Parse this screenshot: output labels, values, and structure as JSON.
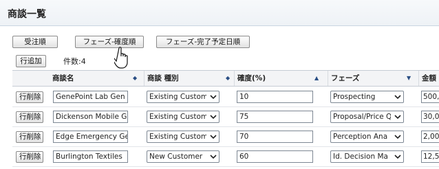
{
  "page": {
    "title": "商談一覧"
  },
  "toolbar": {
    "sort_received": "受注順",
    "sort_phase_certainty": "フェーズ-確度順",
    "sort_phase_close_date": "フェーズ-完了予定日順",
    "add_row": "行追加",
    "count": "件数:4"
  },
  "table": {
    "columns": [
      "商談名",
      "商談 種別",
      "確度(%)",
      "フェーズ",
      "金額"
    ],
    "delete_label": "行削除",
    "rows": [
      {
        "name": "GenePoint Lab Gen",
        "type": "Existing Custom",
        "prob": "10",
        "phase": "Prospecting",
        "amount": "500,0"
      },
      {
        "name": "Dickenson Mobile G",
        "type": "Existing Custom",
        "prob": "75",
        "phase": "Proposal/Price Q",
        "amount": "30,00"
      },
      {
        "name": "Edge Emergency Ge",
        "type": "Existing Custom",
        "prob": "70",
        "phase": "Perception Ana",
        "amount": "2,000"
      },
      {
        "name": "Burlington Textiles",
        "type": "New Customer",
        "prob": "60",
        "phase": "Id. Decision Ma",
        "amount": "12,50"
      }
    ]
  },
  "colors": {
    "header_bg": "#f3f4f6",
    "sort_accent": "#2a4e84",
    "border": "#c6ccd4"
  },
  "icons": {
    "sort_down": "triangle-down-icon",
    "sort_up": "triangle-up-icon",
    "select": "chevron-down-icon",
    "cursor": "hand-pointer-icon"
  }
}
